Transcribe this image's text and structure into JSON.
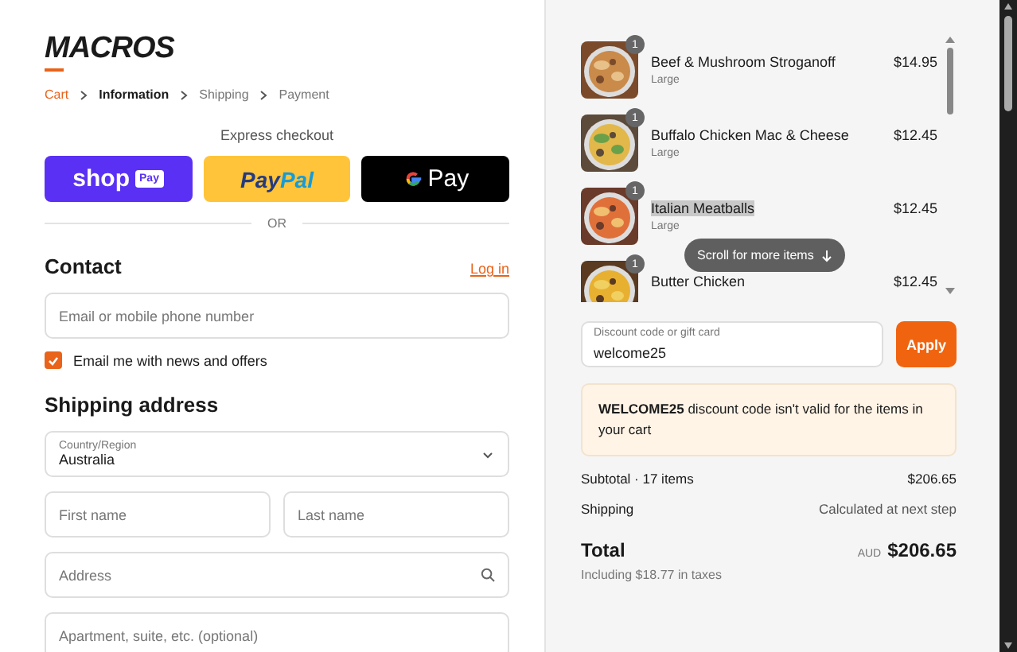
{
  "logo": "MACROS",
  "breadcrumbs": [
    {
      "label": "Cart",
      "kind": "link",
      "selected": false
    },
    {
      "label": "Information",
      "kind": "step",
      "selected": true
    },
    {
      "label": "Shipping",
      "kind": "step",
      "selected": false
    },
    {
      "label": "Payment",
      "kind": "step",
      "selected": false
    }
  ],
  "express_checkout": {
    "title": "Express checkout",
    "shop_pay": {
      "word": "shop",
      "badge": "Pay"
    },
    "paypal": {
      "part_1": "Pay",
      "part_2": "Pal"
    },
    "google_pay": {
      "label": "Pay"
    },
    "divider": "OR"
  },
  "contact": {
    "title": "Contact",
    "login_link": "Log in",
    "email_field": {
      "placeholder": "Email or mobile phone number"
    },
    "newsletter": {
      "label": "Email me with news and offers",
      "checked": true
    }
  },
  "shipping_address": {
    "title": "Shipping address",
    "country": {
      "label": "Country/Region",
      "value": "Australia"
    },
    "first_name": {
      "placeholder": "First name"
    },
    "last_name": {
      "placeholder": "Last name"
    },
    "address": {
      "placeholder": "Address"
    },
    "apartment": {
      "placeholder": "Apartment, suite, etc. (optional)"
    }
  },
  "order_items": [
    {
      "name": "Beef & Mushroom Stroganoff",
      "variant": "Large",
      "price": "$14.95",
      "quantity": "1",
      "highlighted": false
    },
    {
      "name": "Buffalo Chicken Mac & Cheese",
      "variant": "Large",
      "price": "$12.45",
      "quantity": "1",
      "highlighted": false
    },
    {
      "name": "Italian Meatballs",
      "variant": "Large",
      "price": "$12.45",
      "quantity": "1",
      "highlighted": true
    },
    {
      "name": "Butter Chicken",
      "price": "$12.45",
      "quantity": "1",
      "highlighted": false
    }
  ],
  "scroll_hint": "Scroll for more items",
  "discount": {
    "label": "Discount code or gift card",
    "value": "welcome25",
    "button": "Apply"
  },
  "discount_error": "**WELCOME25** discount code isn't valid for the items in your cart",
  "summary": {
    "subtotal_label": "Subtotal · 17 items",
    "subtotal": "$206.65",
    "shipping_label": "Shipping",
    "shipping": "Calculated at next step",
    "total_label": "Total",
    "currency": "AUD",
    "total": "$206.65",
    "taxes": "Including $18.77 in taxes"
  }
}
